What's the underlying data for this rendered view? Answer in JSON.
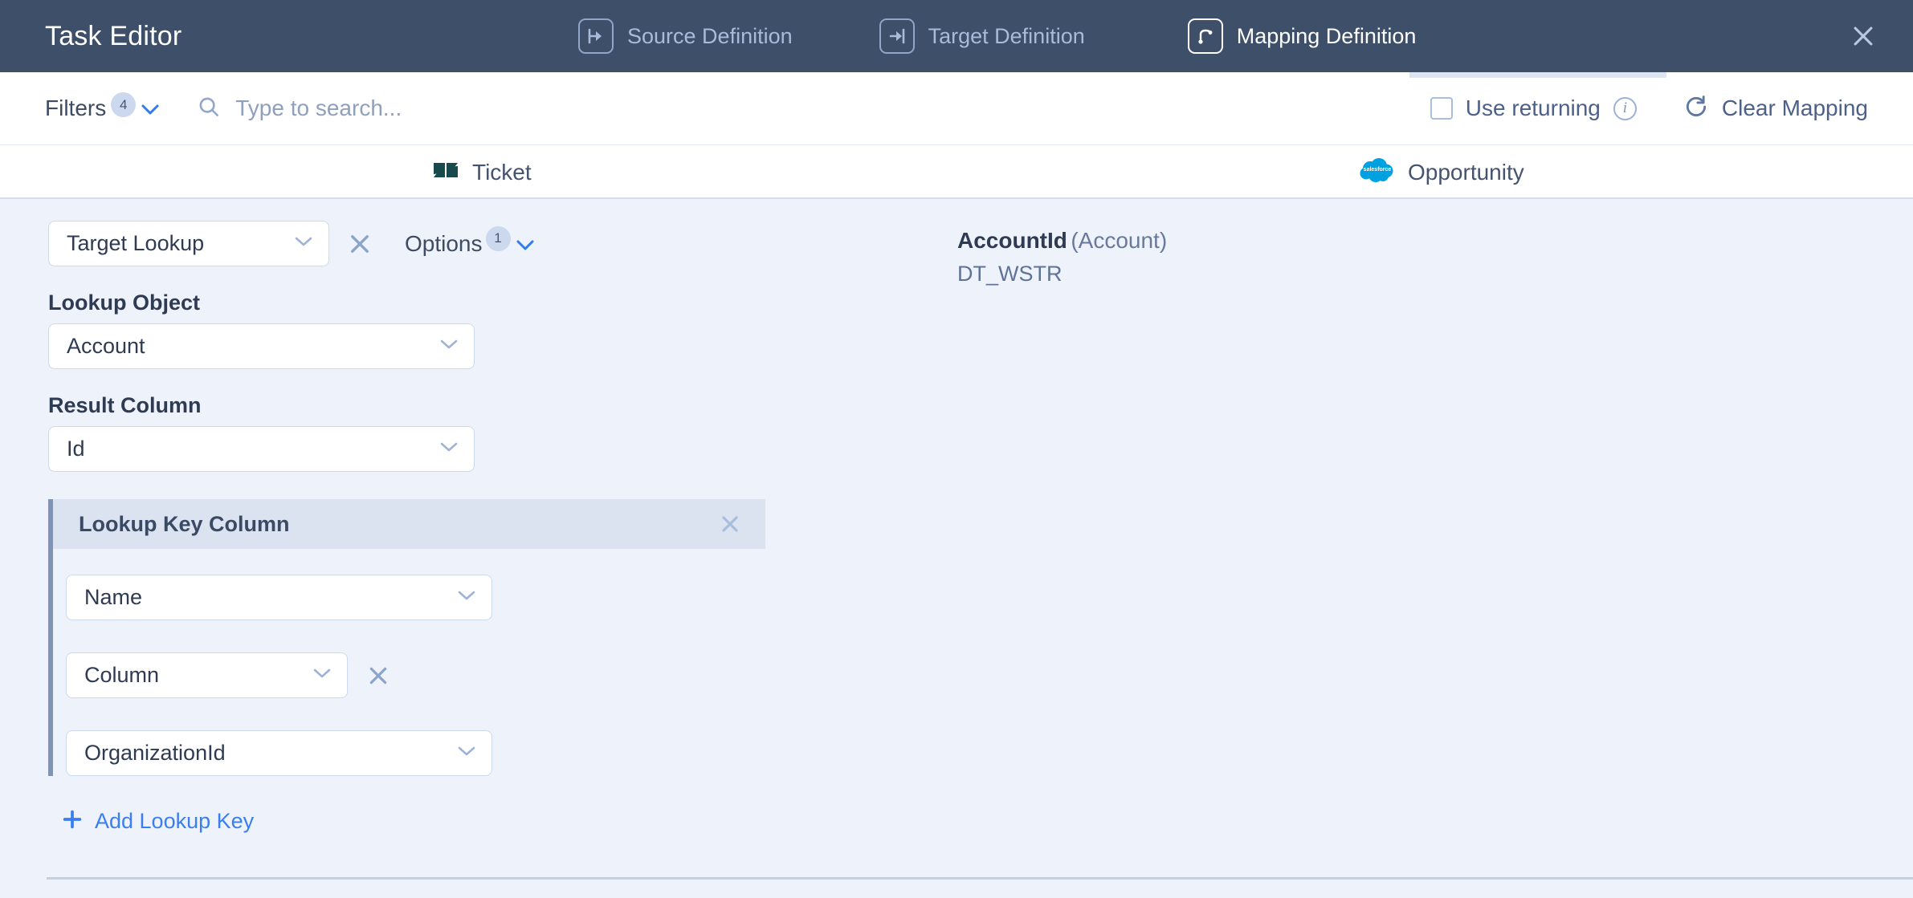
{
  "window": {
    "title": "Task Editor",
    "close_icon": "close-x-icon"
  },
  "nav_tabs": [
    {
      "label": "Source Definition",
      "icon": "source-definition-icon",
      "active": false
    },
    {
      "label": "Target Definition",
      "icon": "target-definition-icon",
      "active": false
    },
    {
      "label": "Mapping Definition",
      "icon": "mapping-definition-icon",
      "active": true
    }
  ],
  "toolbar": {
    "filters_label": "Filters",
    "filters_count": "4",
    "filters_chevron_icon": "chevron-down-icon",
    "search_icon": "search-icon",
    "search_value": "",
    "search_placeholder": "Type to search...",
    "use_returning_label": "Use returning",
    "use_returning_checked": false,
    "info_icon": "info-icon",
    "info_glyph": "i",
    "clear_mapping_label": "Clear Mapping",
    "clear_mapping_icon": "reset-circular-arrow-icon"
  },
  "entities": {
    "source": {
      "label": "Ticket",
      "icon": "zendesk-logo-icon"
    },
    "target": {
      "label": "Opportunity",
      "icon": "salesforce-logo-icon"
    }
  },
  "mapping": {
    "type_select": {
      "value": "Target Lookup",
      "chevron_icon": "chevron-down-icon"
    },
    "remove_icon": "close-x-icon",
    "options_label": "Options",
    "options_count": "1",
    "options_chevron_icon": "chevron-down-icon",
    "lookup_object": {
      "label": "Lookup Object",
      "value": "Account",
      "chevron_icon": "chevron-down-icon"
    },
    "result_column": {
      "label": "Result Column",
      "value": "Id",
      "chevron_icon": "chevron-down-icon"
    },
    "lookup_key_column": {
      "title": "Lookup Key Column",
      "close_icon": "close-x-icon",
      "key_field": {
        "value": "Name",
        "chevron_icon": "chevron-down-icon"
      },
      "source_type": {
        "value": "Column",
        "chevron_icon": "chevron-down-icon"
      },
      "source_type_remove_icon": "close-x-icon",
      "source_column": {
        "value": "OrganizationId",
        "chevron_icon": "chevron-down-icon"
      }
    },
    "add_lookup_key_label": "Add Lookup Key",
    "add_lookup_key_icon": "plus-icon"
  },
  "target_field": {
    "name": "AccountId",
    "object": "(Account)",
    "data_type": "DT_WSTR"
  },
  "colors": {
    "header_bg": "#3d4f69",
    "content_bg": "#eef2fb",
    "accent_link": "#3b7ef0",
    "card_header_bg": "#dbe3f0",
    "card_border": "#8094b5",
    "zendesk_green": "#17494d",
    "salesforce_blue": "#00a1e0"
  }
}
